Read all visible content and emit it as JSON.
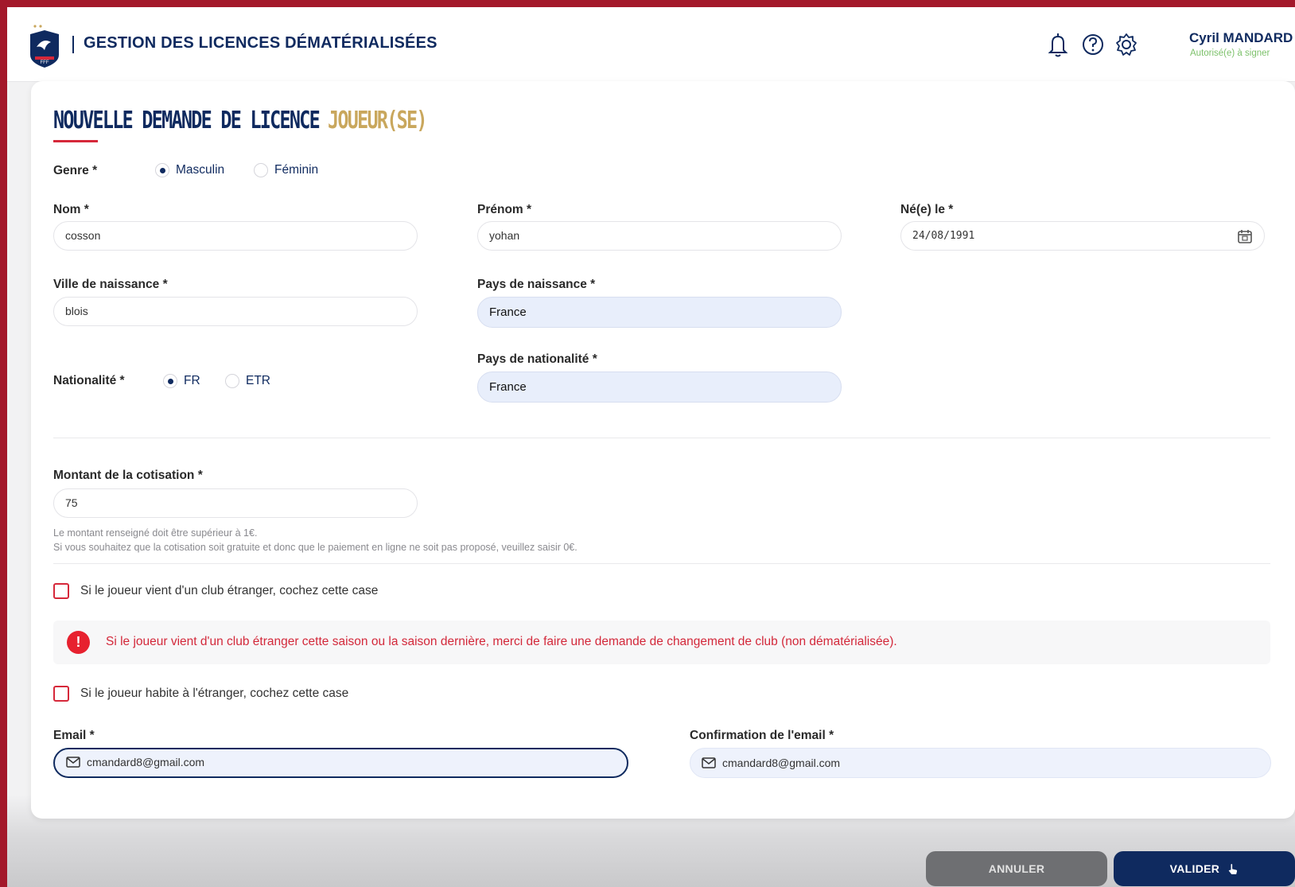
{
  "header": {
    "app_title": "GESTION DES LICENCES DÉMATÉRIALISÉES",
    "logo_name": "fff-logo",
    "icons": [
      "bell-icon",
      "help-icon",
      "gear-icon"
    ],
    "user_name": "Cyril MANDARD",
    "user_role": "Autorisé(e) à signer"
  },
  "form": {
    "title_main": "NOUVELLE DEMANDE DE LICENCE",
    "title_sub": "JOUEUR(SE)",
    "genre": {
      "label": "Genre *",
      "options": [
        "Masculin",
        "Féminin"
      ],
      "selected": "Masculin"
    },
    "nom": {
      "label": "Nom *",
      "value": "cosson"
    },
    "prenom": {
      "label": "Prénom *",
      "value": "yohan"
    },
    "naissance": {
      "label": "Né(e) le *",
      "value": "24/08/1991"
    },
    "ville_naissance": {
      "label": "Ville de naissance *",
      "value": "blois"
    },
    "pays_naissance": {
      "label": "Pays de naissance *",
      "value": "France"
    },
    "nationalite": {
      "label": "Nationalité *",
      "options": [
        "FR",
        "ETR"
      ],
      "selected": "FR"
    },
    "pays_nationalite": {
      "label": "Pays de nationalité *",
      "value": "France"
    },
    "cotisation": {
      "label": "Montant de la cotisation *",
      "value": "75",
      "help_line1": "Le montant renseigné doit être supérieur à 1€.",
      "help_line2": "Si vous souhaitez que la cotisation soit gratuite et donc que le paiement en ligne ne soit pas proposé, veuillez saisir 0€."
    },
    "club_etranger_checkbox": "Si le joueur vient d'un club étranger, cochez cette case",
    "alert_text": "Si le joueur vient d'un club étranger cette saison ou la saison dernière, merci de faire une demande de changement de club (non dématérialisée).",
    "habite_etranger_checkbox": "Si le joueur habite à l'étranger, cochez cette case",
    "email": {
      "label": "Email *",
      "value": "cmandard8@gmail.com"
    },
    "email_confirm": {
      "label": "Confirmation de l'email *",
      "value": "cmandard8@gmail.com"
    }
  },
  "actions": {
    "cancel": "ANNULER",
    "submit": "VALIDER"
  },
  "colors": {
    "brand_navy": "#0f2a5f",
    "brand_gold": "#c9a75d",
    "alert_red": "#d6283a",
    "frame_red": "#a3182a"
  }
}
